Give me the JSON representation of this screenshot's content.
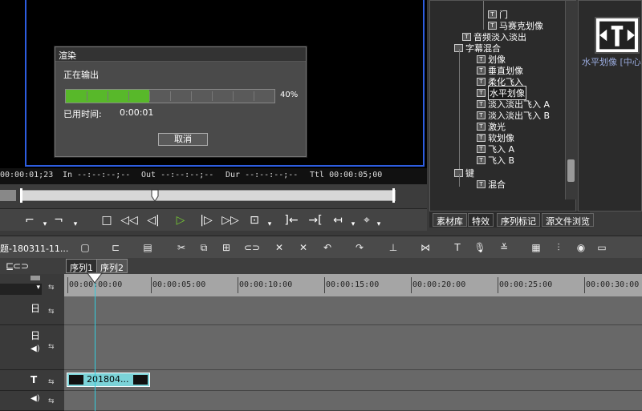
{
  "preview": {
    "timecodes": {
      "current": "00:00:01;23",
      "in": "In --:--:--;--",
      "out": "Out --:--:--;--",
      "dur": "Dur --:--:--;--",
      "total": "Ttl 00:00:05;00"
    }
  },
  "render_dialog": {
    "title": "渲染",
    "status": "正在输出",
    "progress_percent": 40,
    "progress_text": "40%",
    "elapsed_label": "已用时间:",
    "elapsed_value": "0:00:01",
    "cancel_label": "取消"
  },
  "effects_tree": {
    "items": [
      {
        "label": "门"
      },
      {
        "label": "马赛克划像"
      },
      {
        "label": "音频淡入淡出"
      },
      {
        "label": "字幕混合"
      },
      {
        "label": "划像"
      },
      {
        "label": "垂直划像"
      },
      {
        "label": "柔化飞入"
      },
      {
        "label": "水平划像"
      },
      {
        "label": "淡入淡出飞入 A"
      },
      {
        "label": "淡入淡出飞入 B"
      },
      {
        "label": "激光"
      },
      {
        "label": "软划像"
      },
      {
        "label": "飞入 A"
      },
      {
        "label": "飞入 B"
      },
      {
        "label": "键"
      },
      {
        "label": "混合"
      }
    ]
  },
  "panel_tabs": [
    "素材库",
    "特效",
    "序列标记",
    "源文件浏览"
  ],
  "fx_preview": {
    "label": "水平划像 [中心..."
  },
  "timeline": {
    "project_name": "题-180311-11...",
    "sequences": [
      "序列1",
      "序列2"
    ],
    "ruler": [
      "00:00:00:00",
      "00:00:05:00",
      "00:00:10:00",
      "00:00:15:00",
      "00:00:20:00",
      "00:00:25:00",
      "00:00:30:00"
    ],
    "clip_label": "201804..."
  },
  "colors": {
    "accent": "#58b82a",
    "frame": "#2d5de0",
    "clip": "#7bd3d8",
    "playhead": "#33ccdd"
  }
}
